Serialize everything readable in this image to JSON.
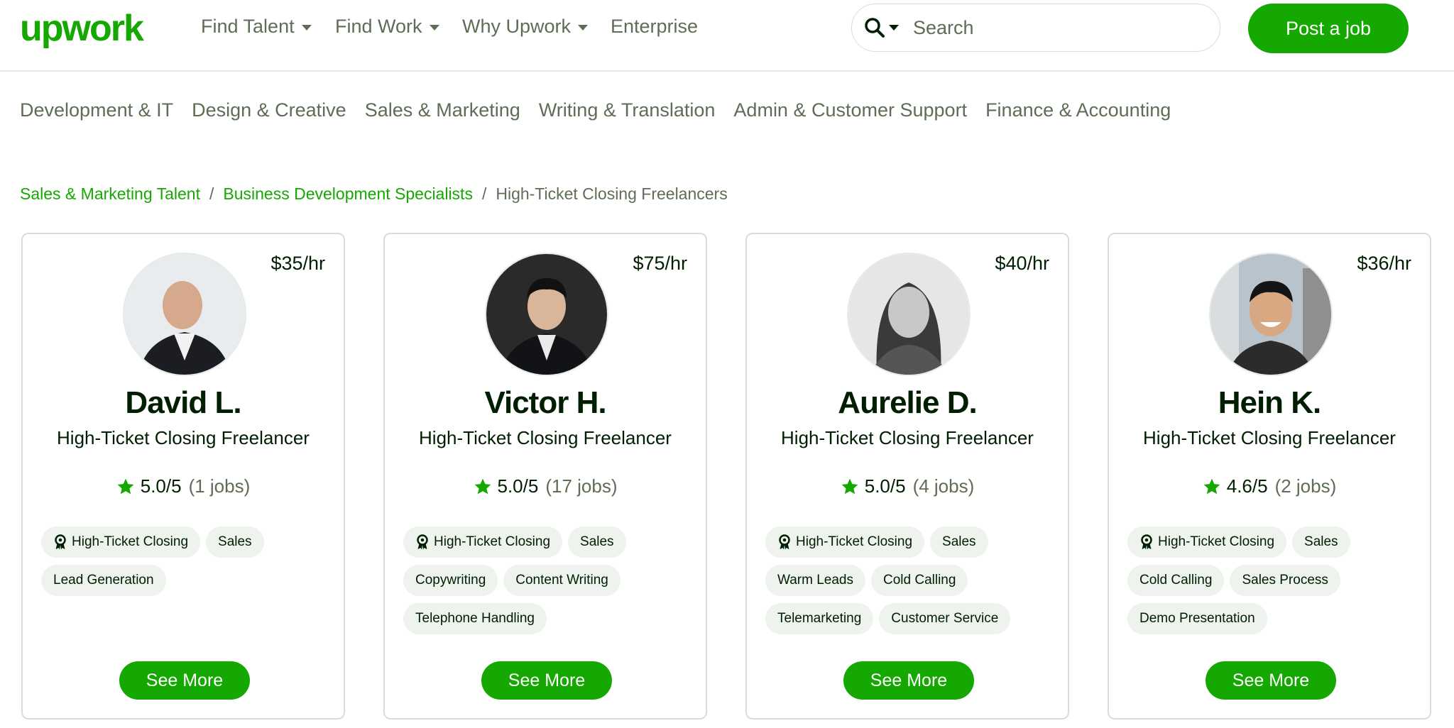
{
  "brand": {
    "logo_text": "upwork",
    "color": "#14a800"
  },
  "topnav": [
    {
      "label": "Find Talent",
      "has_dropdown": true
    },
    {
      "label": "Find Work",
      "has_dropdown": true
    },
    {
      "label": "Why Upwork",
      "has_dropdown": true
    },
    {
      "label": "Enterprise",
      "has_dropdown": false
    }
  ],
  "search": {
    "placeholder": "Search",
    "icon": "search-icon"
  },
  "post_job_label": "Post a job",
  "categories": [
    "Development & IT",
    "Design & Creative",
    "Sales & Marketing",
    "Writing & Translation",
    "Admin & Customer Support",
    "Finance & Accounting"
  ],
  "breadcrumb": {
    "items": [
      "Sales & Marketing Talent",
      "Business Development Specialists"
    ],
    "separator": "/",
    "current": "High-Ticket Closing Freelancers"
  },
  "freelancers": [
    {
      "rate": "$35/hr",
      "name": "David L.",
      "title": "High-Ticket Closing Freelancer",
      "score": "5.0/5",
      "jobs": "(1 jobs)",
      "tags": [
        "High-Ticket Closing",
        "Sales",
        "Lead Generation"
      ],
      "cta": "See More"
    },
    {
      "rate": "$75/hr",
      "name": "Victor H.",
      "title": "High-Ticket Closing Freelancer",
      "score": "5.0/5",
      "jobs": "(17 jobs)",
      "tags": [
        "High-Ticket Closing",
        "Sales",
        "Copywriting",
        "Content Writing",
        "Telephone Handling"
      ],
      "cta": "See More"
    },
    {
      "rate": "$40/hr",
      "name": "Aurelie D.",
      "title": "High-Ticket Closing Freelancer",
      "score": "5.0/5",
      "jobs": "(4 jobs)",
      "tags": [
        "High-Ticket Closing",
        "Sales",
        "Warm Leads",
        "Cold Calling",
        "Telemarketing",
        "Customer Service"
      ],
      "cta": "See More"
    },
    {
      "rate": "$36/hr",
      "name": "Hein K.",
      "title": "High-Ticket Closing Freelancer",
      "score": "4.6/5",
      "jobs": "(2 jobs)",
      "tags": [
        "High-Ticket Closing",
        "Sales",
        "Cold Calling",
        "Sales Process",
        "Demo Presentation"
      ],
      "cta": "See More"
    }
  ]
}
